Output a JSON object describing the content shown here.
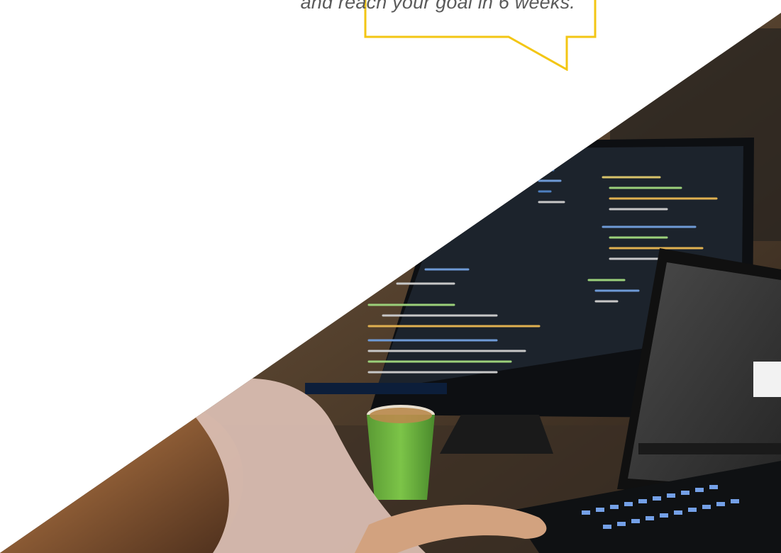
{
  "tagline": "and reach your goal in 6 weeks.",
  "photo": {
    "subject": "workspace-photo",
    "icon": "photo-icon"
  },
  "colors": {
    "accent": "#f3c614",
    "text": "#5b5b5b",
    "background": "#ffffff"
  }
}
